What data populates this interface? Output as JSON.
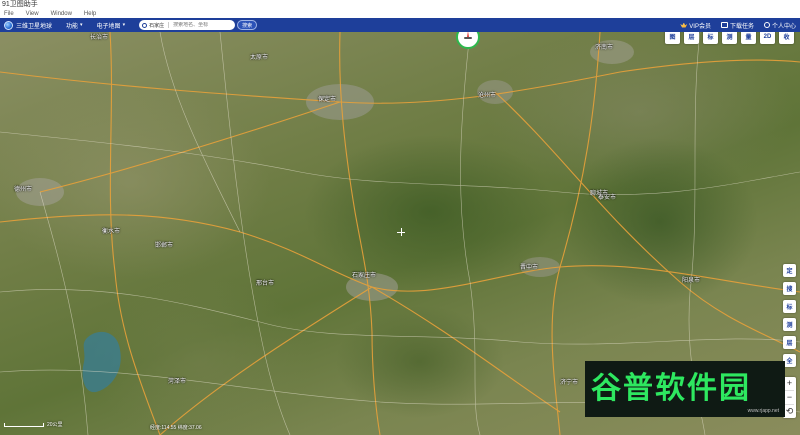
{
  "window": {
    "title": "91卫图助手"
  },
  "menu": {
    "items": [
      "File",
      "View",
      "Window",
      "Help"
    ]
  },
  "toolbar": {
    "brand": "三维卫星地球",
    "tab_label": "功能",
    "layer_label": "电子地图",
    "search": {
      "location": "石家庄",
      "placeholder": "搜索地名、坐标",
      "button": "搜索"
    },
    "right": {
      "vip": "VIP会员",
      "tasks": "下载任务",
      "user": "个人中心"
    }
  },
  "map": {
    "cities": [
      {
        "name": "保定市"
      },
      {
        "name": "石家庄市"
      },
      {
        "name": "邢台市"
      },
      {
        "name": "衡水市"
      },
      {
        "name": "沧州市"
      },
      {
        "name": "晋中市"
      },
      {
        "name": "阳泉市"
      },
      {
        "name": "德州市"
      },
      {
        "name": "邯郸市"
      },
      {
        "name": "聊城市"
      },
      {
        "name": "济南市"
      },
      {
        "name": "泰安市"
      },
      {
        "name": "太原市"
      },
      {
        "name": "长治市"
      },
      {
        "name": "菏泽市"
      },
      {
        "name": "济宁市"
      }
    ],
    "tools_top": [
      "图",
      "层",
      "标",
      "测",
      "量",
      "2D",
      "收"
    ],
    "tools_right": [
      "定",
      "搜",
      "标",
      "测",
      "层",
      "全"
    ],
    "zoom": {
      "in": "+",
      "out": "−",
      "reset": "⟲"
    },
    "scale": "20公里",
    "status": "经度:114.55 纬度:37.06"
  },
  "watermark": {
    "main": "谷普软件园",
    "sub": "www.rjapp.net"
  },
  "colors": {
    "toolbar": "#1e3f9a",
    "compass": "#2db84c",
    "watermark": "#2ee860"
  }
}
